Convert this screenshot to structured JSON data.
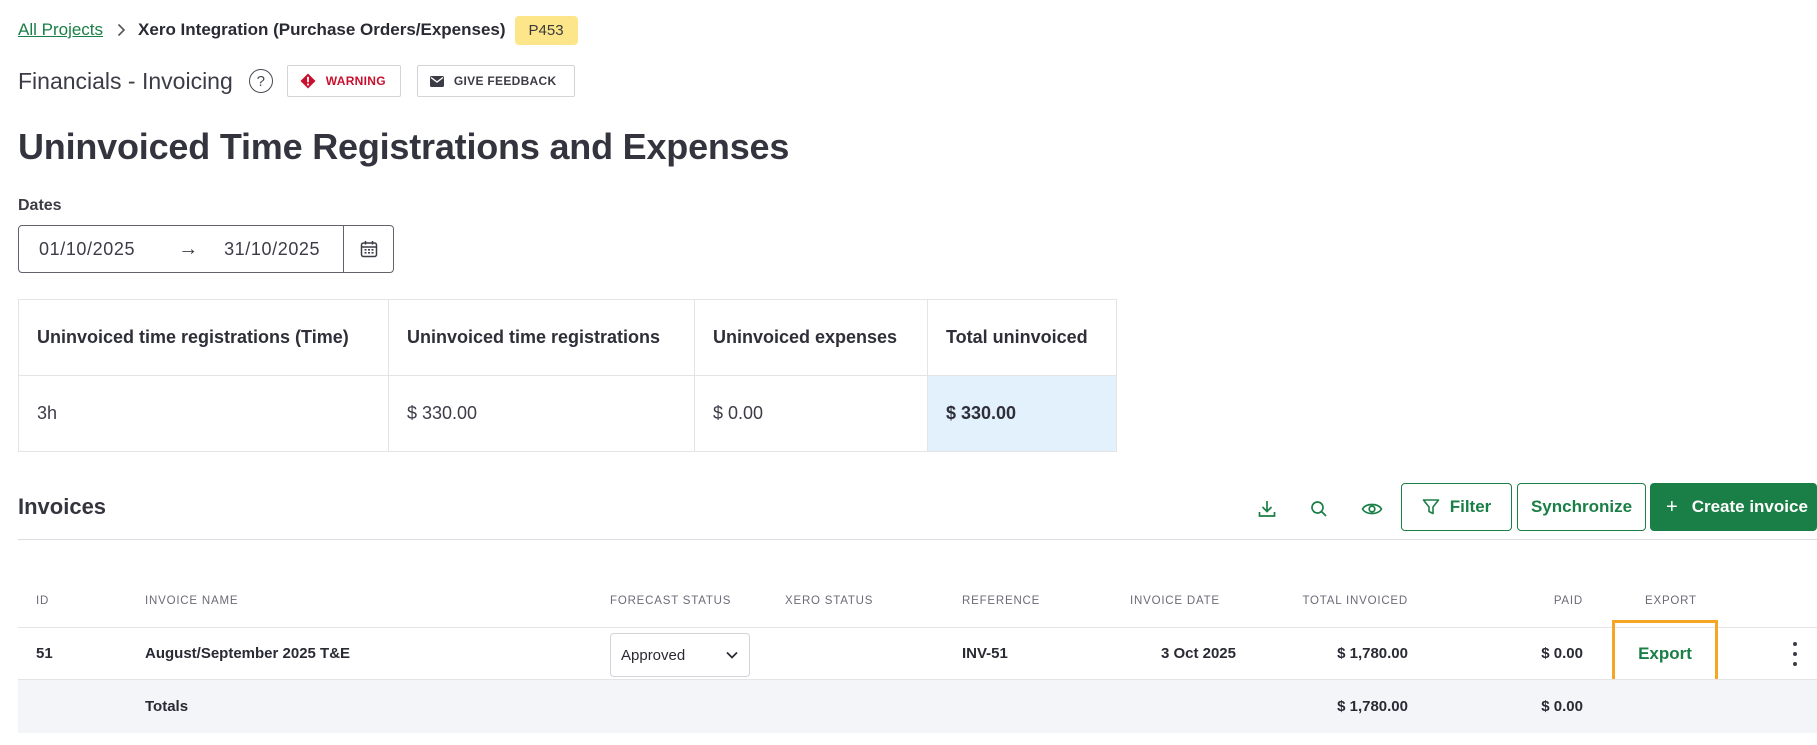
{
  "breadcrumb": {
    "root_label": "All Projects",
    "current_label": "Xero Integration (Purchase Orders/Expenses)",
    "project_id": "P453"
  },
  "section": {
    "title": "Financials - Invoicing",
    "help_glyph": "?",
    "warning_label": "WARNING",
    "feedback_label": "GIVE FEEDBACK"
  },
  "page_title": "Uninvoiced Time Registrations and Expenses",
  "dates": {
    "label": "Dates",
    "start": "01/10/2025",
    "arrow": "→",
    "end": "31/10/2025"
  },
  "summary": {
    "headers": [
      "Uninvoiced time registrations (Time)",
      "Uninvoiced time registrations",
      "Uninvoiced expenses",
      "Total uninvoiced"
    ],
    "values": [
      "3h",
      "$ 330.00",
      "$ 0.00",
      "$ 330.00"
    ]
  },
  "invoices": {
    "title": "Invoices",
    "filter_label": "Filter",
    "sync_label": "Synchronize",
    "create_label": "Create invoice",
    "create_prefix": "+",
    "columns": {
      "id": "ID",
      "name": "INVOICE NAME",
      "forecast_status": "FORECAST STATUS",
      "xero_status": "XERO STATUS",
      "reference": "REFERENCE",
      "date": "INVOICE DATE",
      "total": "TOTAL INVOICED",
      "paid": "PAID",
      "export": "EXPORT"
    },
    "rows": [
      {
        "id": "51",
        "name": "August/September 2025 T&E",
        "forecast_status": "Approved",
        "xero_status": "",
        "reference": "INV-51",
        "date": "3 Oct 2025",
        "total": "$ 1,780.00",
        "paid": "$ 0.00",
        "export": "Export"
      }
    ],
    "totals": {
      "label": "Totals",
      "total": "$ 1,780.00",
      "paid": "$ 0.00"
    }
  },
  "colors": {
    "accent_green": "#1a7f46",
    "warning_red": "#c8102e",
    "badge_yellow": "#fde68a",
    "highlight_blue": "#e3f1fd",
    "focus_orange": "#f5a623"
  },
  "icons": [
    "chevron-right-icon",
    "help-icon",
    "warning-diamond-icon",
    "envelope-icon",
    "calendar-icon",
    "download-icon",
    "search-icon",
    "eye-icon",
    "filter-icon",
    "chevron-down-icon",
    "kebab-menu-icon"
  ]
}
